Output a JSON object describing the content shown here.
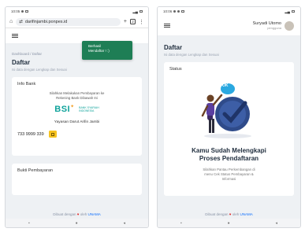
{
  "left": {
    "statusbar": {
      "time": "10:05"
    },
    "browser": {
      "url": "darifinjambi.ponpes.id",
      "tab_count": "2"
    },
    "toast": {
      "line1": "Berhasil",
      "line2": "Mendaftar ! :)"
    },
    "breadcrumb": "Dashboard / Daftar",
    "title": "Daftar",
    "subtitle": "Isi data dengan Lengkap dan Sesuai",
    "bank_card": {
      "title": "Info Bank",
      "instruction_1": "Silahkan Melakukan Pembayaran ke",
      "instruction_2": "Rekening Bank Dibawah Ini",
      "bank_name": "BSI",
      "bank_sub_1": "BANK SYARIAH",
      "bank_sub_2": "INDONESIA",
      "account_holder": "Yayasan Darut Arifin Jambi",
      "account_number": "733 9999 339"
    },
    "payment_card": {
      "title": "Bukti Pembayaran"
    },
    "footer": {
      "text": "Dibuat dengan",
      "by": "oleh",
      "brand": "UNAMA"
    }
  },
  "right": {
    "statusbar": {
      "time": "10:06"
    },
    "header": {
      "user_name": "Suryadi Utomo",
      "user_role": "pengguna"
    },
    "title": "Daftar",
    "subtitle": "Isi data dengan Lengkap dan Sesuai",
    "status_card": {
      "title": "Status",
      "badge": "OK",
      "done_line1": "Kamu Sudah Melengkapi",
      "done_line2": "Proses Pendaftaran",
      "desc_1": "Silahkan Pantau Perkembangan di",
      "desc_2": "menu Cek Status Pembayaran &",
      "desc_3": "Informasi"
    },
    "footer": {
      "text": "Dibuat dengan",
      "by": "oleh",
      "brand": "UNAMA"
    }
  },
  "nav_icons": [
    "square",
    "circle",
    "triangle"
  ],
  "colors": {
    "toast": "#1e7e55",
    "bsi": "#0fa39b",
    "copy": "#f6c320",
    "check": "#2f4b8a",
    "accent_blue": "#0d6efd"
  }
}
